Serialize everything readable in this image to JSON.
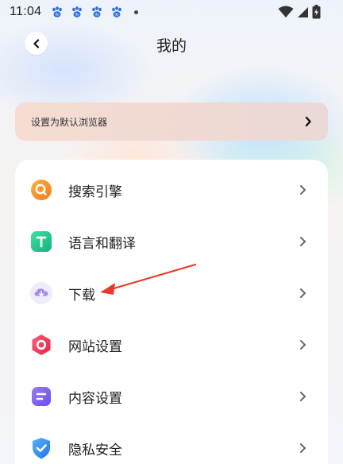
{
  "status_bar": {
    "time": "11:04"
  },
  "header": {
    "title": "我的"
  },
  "banner": {
    "label": "设置为默认浏览器"
  },
  "menu": {
    "items": [
      {
        "label": "搜索引擎",
        "icon": "search-engine-icon",
        "color": "#f5902a"
      },
      {
        "label": "语言和翻译",
        "icon": "translate-icon",
        "color": "#23c48e"
      },
      {
        "label": "下载",
        "icon": "download-cloud-icon",
        "color": "#a58bf0"
      },
      {
        "label": "网站设置",
        "icon": "website-settings-icon",
        "color": "#f03a5c"
      },
      {
        "label": "内容设置",
        "icon": "content-settings-icon",
        "color": "#7b63ec"
      },
      {
        "label": "隐私安全",
        "icon": "shield-check-icon",
        "color": "#2f8df2"
      }
    ]
  },
  "colors": {
    "annotation_arrow": "#e8392c",
    "card_bg": "#ffffff"
  }
}
